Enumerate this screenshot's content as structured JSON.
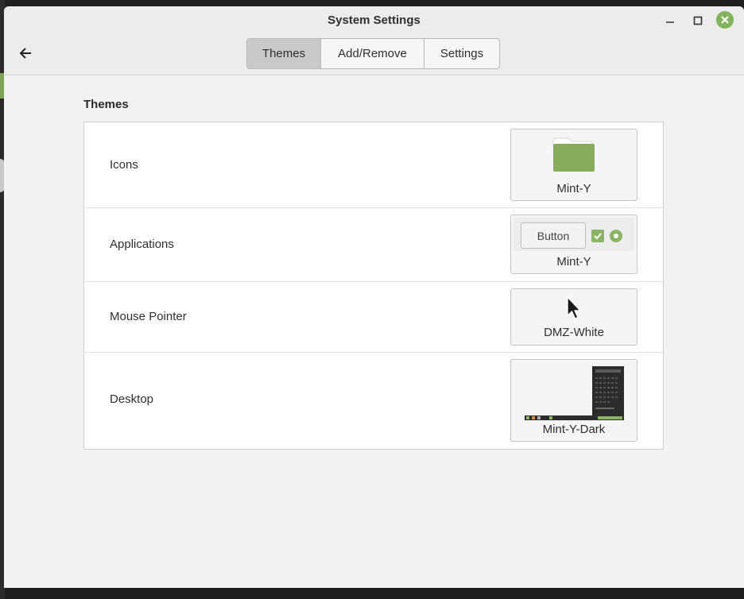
{
  "window": {
    "title": "System Settings"
  },
  "tabs": [
    {
      "label": "Themes",
      "active": true
    },
    {
      "label": "Add/Remove",
      "active": false
    },
    {
      "label": "Settings",
      "active": false
    }
  ],
  "section": {
    "title": "Themes"
  },
  "rows": [
    {
      "label": "Icons",
      "value": "Mint-Y",
      "preview_icon": "folder-icon"
    },
    {
      "label": "Applications",
      "value": "Mint-Y",
      "preview_button": "Button"
    },
    {
      "label": "Mouse Pointer",
      "value": "DMZ-White",
      "preview_icon": "cursor-icon"
    },
    {
      "label": "Desktop",
      "value": "Mint-Y-Dark",
      "preview_icon": "desktop-preview"
    }
  ],
  "colors": {
    "accent": "#8ab364",
    "close_button": "#80b35a"
  }
}
